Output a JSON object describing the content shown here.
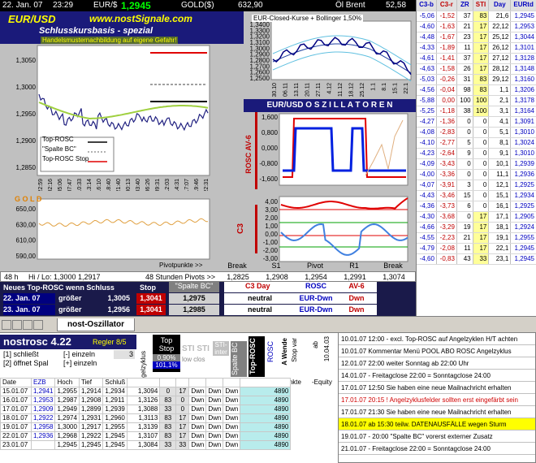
{
  "topbar": {
    "date": "22. Jan. 07",
    "time": "23:29",
    "pair": "EUR/$",
    "price": "1,2945",
    "gold_label": "GOLD($)",
    "gold_value": "632,90",
    "oil_label": "Öl Brent",
    "oil_value": "52,58"
  },
  "main_chart": {
    "title": "EUR/USD",
    "site": "www.nostSignale.com",
    "subtitle": "Schlusskursbasis - spezial",
    "note": "Handelsmusternachbildung auf eigene Gefahr!",
    "yticks": [
      "1,3050",
      "1,3000",
      "1,2950",
      "1,2900",
      "1,2850"
    ],
    "xticks": [
      "22:59",
      "02:16",
      "05:06",
      "07:47",
      "10:33",
      "13:14",
      "16:10",
      "18:40",
      "21:40",
      "00:13",
      "03:40",
      "06:26",
      "09:31",
      "12:03",
      "14:31",
      "17:07",
      "19:46",
      "22:31"
    ],
    "legend": [
      "Top-ROSC",
      "\"Spalte BC\"",
      "Top-ROSC Stop"
    ]
  },
  "gold_chart": {
    "title": "G O L D",
    "yticks": [
      "650,00",
      "630,00",
      "610,00",
      "590,00"
    ],
    "pivot_label": "Pivotpunkte >>"
  },
  "bollinger": {
    "title": "EUR-Closed-Kurse + Bollinger 1,50%",
    "yticks": [
      "1,3400",
      "1,3300",
      "1,3200",
      "1,3100",
      "1,3000",
      "1,2900",
      "1,2800",
      "1,2700",
      "1,2600",
      "1,2500"
    ],
    "xticks": [
      "30.10",
      "06.11",
      "13.11",
      "20.11",
      "27.11",
      "4.12",
      "11.12",
      "18.12",
      "25.12",
      "1.1",
      "8.1",
      "15.1",
      "22.1"
    ]
  },
  "osc": {
    "title": "EUR/USD  O S Z I L L A T O R E N",
    "rosc_label": "ROSC AV-6",
    "rosc_yticks": [
      "1,600",
      "0,800",
      "0,000",
      "-0,800",
      "-1,600"
    ],
    "c3_label": "C3",
    "c3_yticks": [
      "4,00",
      "3,00",
      "2,00",
      "1,00",
      "0,00",
      "-1,00",
      "-2,00",
      "-3,00"
    ]
  },
  "pivots": {
    "labels": [
      "Break",
      "S1",
      "Pivot",
      "R1",
      "Break"
    ],
    "values": [
      "1,2825",
      "1,2908",
      "1,2954",
      "1,2991",
      "1,3074"
    ]
  },
  "hilo": {
    "label": "48 h",
    "hilo": "Hi / Lo: 1,3000   1,2917",
    "pivots48": "48 Stunden Pivots >>"
  },
  "signal": {
    "header": "Neues Top-ROSC wenn Schluss",
    "stop": "Stop",
    "spalte": "\"Spalte BC\"",
    "c3day": "C3  Day",
    "rosc": "ROSC",
    "av6": "AV-6",
    "rows": [
      {
        "date": "22. Jan. 07",
        "cond": "größer",
        "val": "1,3005",
        "stop": "1,3041",
        "spalte": "1,2975",
        "c3": "neutral",
        "rosc": "EUR-Dwn",
        "av6": "Dwn"
      },
      {
        "date": "23. Jan. 07",
        "cond": "größer",
        "val": "1,2956",
        "stop": "1,3041",
        "spalte": "1,2985",
        "c3": "neutral",
        "rosc": "EUR-Dwn",
        "av6": "Dwn"
      }
    ]
  },
  "right_table": {
    "headers": [
      "C3-b",
      "C3-r",
      "ZR",
      "STI",
      "Day",
      "EURtd"
    ],
    "rows": [
      [
        "-5,06",
        "-1,52",
        "37",
        "83",
        "21,6",
        "1,2945"
      ],
      [
        "-4,60",
        "-1,63",
        "21",
        "17",
        "22,12",
        "1,2953"
      ],
      [
        "-4,48",
        "-1,67",
        "23",
        "17",
        "25,12",
        "1,3044"
      ],
      [
        "-4,33",
        "-1,89",
        "11",
        "17",
        "26,12",
        "1,3101"
      ],
      [
        "-4,61",
        "-1,41",
        "37",
        "17",
        "27,12",
        "1,3128"
      ],
      [
        "-4,63",
        "-1,58",
        "26",
        "17",
        "28,12",
        "1,3148"
      ],
      [
        "-5,03",
        "-0,26",
        "31",
        "83",
        "29,12",
        "1,3160"
      ],
      [
        "-4,56",
        "-0,04",
        "98",
        "83",
        "1,1",
        "1,3206"
      ],
      [
        "-5,88",
        "0,00",
        "100",
        "100",
        "2,1",
        "1,3178"
      ],
      [
        "-5,25",
        "-1,18",
        "38",
        "100",
        "3,1",
        "1,3164"
      ],
      [
        "-4,27",
        "-1,36",
        "0",
        "0",
        "4,1",
        "1,3091"
      ],
      [
        "-4,08",
        "-2,83",
        "0",
        "0",
        "5,1",
        "1,3010"
      ],
      [
        "-4,10",
        "-2,77",
        "5",
        "0",
        "8,1",
        "1,3024"
      ],
      [
        "-4,23",
        "-2,64",
        "9",
        "0",
        "9,1",
        "1,3010"
      ],
      [
        "-4,09",
        "-3,43",
        "0",
        "0",
        "10,1",
        "1,2939"
      ],
      [
        "-4,00",
        "-3,36",
        "0",
        "0",
        "11,1",
        "1,2936"
      ],
      [
        "-4,07",
        "-3,91",
        "3",
        "0",
        "12,1",
        "1,2925"
      ],
      [
        "-4,43",
        "-3,46",
        "15",
        "0",
        "15,1",
        "1,2934"
      ],
      [
        "-4,36",
        "-3,73",
        "6",
        "0",
        "16,1",
        "1,2925"
      ],
      [
        "-4,30",
        "-3,68",
        "0",
        "17",
        "17,1",
        "1,2905"
      ],
      [
        "-4,66",
        "-3,29",
        "19",
        "17",
        "18,1",
        "1,2924"
      ],
      [
        "-4,55",
        "-2,23",
        "21",
        "17",
        "19,1",
        "1,2955"
      ],
      [
        "-4,79",
        "-2,08",
        "11",
        "17",
        "22,1",
        "1,2945"
      ],
      [
        "-4,60",
        "-0,83",
        "43",
        "33",
        "23,1",
        "1,2945"
      ]
    ]
  },
  "tab": {
    "label": "nost-Oszillator"
  },
  "bottom": {
    "title": "nostrosc 4.22",
    "regler": "Regler 8/5",
    "schliesst": "[1] schließt",
    "offnet": "[2] öffnet Spal",
    "einzeln1": "[-] einzeln",
    "einzeln2": "[+] einzeln",
    "count": "3",
    "hdr": [
      "Date",
      "EZB",
      "Hoch",
      "Tief",
      "Schluß"
    ],
    "winkel": "Angelzyklus",
    "topstop": "Top Stop",
    "pct": "0,90%",
    "stop_val": "101,1%",
    "sti": "STI STI",
    "lowclose": "low clos",
    "stiinter": "STI-inter",
    "spalte": "Spalte BC",
    "toprosc": "Top-ROSC",
    "rosc": "ROSC",
    "wende": "A Wende",
    "stopvar": "Stop var",
    "ab": "ab",
    "abdate": "10.04.03",
    "punkte": "Punkte",
    "equity": "-Equity",
    "rows": [
      [
        "15.01.07",
        "1,2941",
        "1,2955",
        "1,2914",
        "1,2934",
        "1,3094",
        "0",
        "17",
        "Dwn",
        "Dwn",
        "Dwn",
        "4890"
      ],
      [
        "16.01.07",
        "1,2953",
        "1,2987",
        "1,2908",
        "1,2911",
        "1,3126",
        "83",
        "0",
        "Dwn",
        "Dwn",
        "Dwn",
        "4890"
      ],
      [
        "17.01.07",
        "1,2909",
        "1,2949",
        "1,2899",
        "1,2939",
        "1,3088",
        "33",
        "0",
        "Dwn",
        "Dwn",
        "Dwn",
        "4890"
      ],
      [
        "18.01.07",
        "1,2922",
        "1,2974",
        "1,2931",
        "1,2960",
        "1,3113",
        "83",
        "17",
        "Dwn",
        "Dwn",
        "Dwn",
        "4890"
      ],
      [
        "19.01.07",
        "1,2958",
        "1,3000",
        "1,2917",
        "1,2955",
        "1,3139",
        "83",
        "17",
        "Dwn",
        "Dwn",
        "Dwn",
        "4890"
      ],
      [
        "22.01.07",
        "1,2936",
        "1,2968",
        "1,2922",
        "1,2945",
        "1,3107",
        "83",
        "17",
        "Dwn",
        "Dwn",
        "Dwn",
        "4890"
      ],
      [
        "23.01.07",
        "",
        "1,2945",
        "1,2945",
        "1,2945",
        "1,3084",
        "33",
        "33",
        "Dwn",
        "Dwn",
        "Dwn",
        "4890"
      ]
    ]
  },
  "messages": [
    {
      "text": "10.01.07 12:00 - excl. Top-ROSC auf Angelzyklen H/T achten",
      "hl": false
    },
    {
      "text": "10.01.07 Kommentar Menü POOL ABO ROSC Angelzyklus",
      "hl": false
    },
    {
      "text": "12.01.07 22:00 weiter Sonntag ab 22:00 Uhr",
      "hl": false
    },
    {
      "text": "14.01.07 - Freitagclose 22:00 = Sonntagclose 24:00",
      "hl": false
    },
    {
      "text": "17.01.07 12:50 Sie haben eine neue Mailnachricht erhalten",
      "hl": false
    },
    {
      "text": "17.01.07 20:15 ! Angelzyklusfelder sollten erst eingefärbt sein",
      "hl": false,
      "red": true
    },
    {
      "text": "17.01.07 21:30 Sie haben eine neue Mailnachricht erhalten",
      "hl": false
    },
    {
      "text": "18.01.07 ab 15:30 teilw. DATENAUSFÄLLE wegen Sturm",
      "hl": true
    },
    {
      "text": "19.01.07 - 20:00 \"Spalte BC\" vorerst externer Zusatz",
      "hl": false
    },
    {
      "text": "21.01.07 - Freitagclose 22:00 = Sonntagclose 24:00",
      "hl": false
    }
  ]
}
